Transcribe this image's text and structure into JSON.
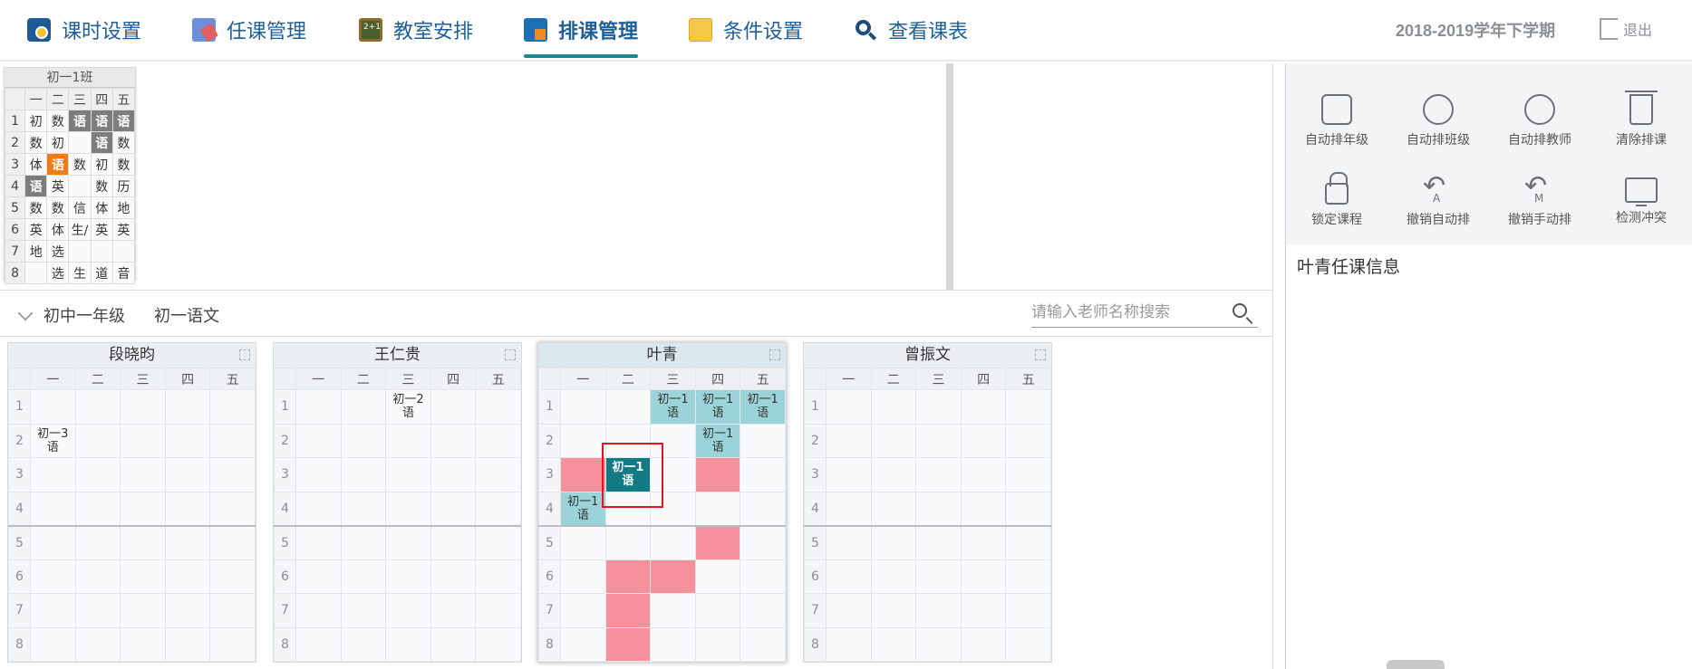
{
  "nav": {
    "items": [
      {
        "label": "课时设置",
        "icon": "clock-icon",
        "color": "#1e5a94"
      },
      {
        "label": "任课管理",
        "icon": "teacher-assign-icon",
        "color": "#3b6fb5"
      },
      {
        "label": "教室安排",
        "icon": "blackboard-icon",
        "color": "#556b2f"
      },
      {
        "label": "排课管理",
        "icon": "schedule-grid-icon",
        "color": "#1c6fb5"
      },
      {
        "label": "条件设置",
        "icon": "note-icon",
        "color": "#e8b93a"
      },
      {
        "label": "查看课表",
        "icon": "search-icon",
        "color": "#1f4d7a"
      }
    ],
    "active_index": 3,
    "term": "2018-2019学年下学期",
    "logout": "退出"
  },
  "preview": {
    "title": "初一1班",
    "days": [
      "一",
      "二",
      "三",
      "四",
      "五"
    ],
    "rows": [
      {
        "n": "1",
        "cells": [
          "初",
          "数",
          "语",
          "语",
          "语"
        ],
        "hl": [
          2,
          3,
          4
        ]
      },
      {
        "n": "2",
        "cells": [
          "数",
          "初",
          "",
          "语",
          "数"
        ],
        "hl": [
          3
        ]
      },
      {
        "n": "3",
        "cells": [
          "体",
          "语",
          "数",
          "初",
          "数"
        ],
        "or": [
          1
        ]
      },
      {
        "n": "4",
        "cells": [
          "语",
          "英",
          "",
          "数",
          "历"
        ],
        "hl": [
          0
        ]
      },
      {
        "n": "5",
        "cells": [
          "数",
          "数",
          "信",
          "体",
          "地"
        ]
      },
      {
        "n": "6",
        "cells": [
          "英",
          "体",
          "生/",
          "英",
          "英"
        ]
      },
      {
        "n": "7",
        "cells": [
          "地",
          "选",
          "",
          "",
          ""
        ]
      },
      {
        "n": "8",
        "cells": [
          "",
          "选",
          "生",
          "道",
          "音"
        ]
      }
    ]
  },
  "filter": {
    "grade": "初中一年级",
    "subject": "初一语文",
    "search_placeholder": "请输入老师名称搜索"
  },
  "teachers": [
    {
      "name": "段晓昀",
      "cells": {
        "2-0": {
          "t": "初一3\n语",
          "c": "plain"
        }
      }
    },
    {
      "name": "王仁贵",
      "cells": {
        "1-2": {
          "t": "初一2\n语",
          "c": "plain"
        }
      }
    },
    {
      "name": "叶青",
      "selected": true,
      "cells": {
        "1-2": {
          "t": "初一1\n语",
          "c": "teal"
        },
        "1-3": {
          "t": "初一1\n语",
          "c": "teal"
        },
        "1-4": {
          "t": "初一1\n语",
          "c": "teal"
        },
        "2-3": {
          "t": "初一1\n语",
          "c": "teal"
        },
        "3-0": {
          "t": "",
          "c": "pink"
        },
        "3-1": {
          "t": "初一1\n语",
          "c": "dark"
        },
        "3-3": {
          "t": "",
          "c": "pink"
        },
        "4-0": {
          "t": "初一1\n语",
          "c": "teal"
        },
        "5-3": {
          "t": "",
          "c": "pink"
        },
        "6-1": {
          "t": "",
          "c": "pink"
        },
        "6-2": {
          "t": "",
          "c": "pink"
        },
        "7-1": {
          "t": "",
          "c": "pink"
        },
        "8-1": {
          "t": "",
          "c": "pink"
        }
      }
    },
    {
      "name": "曾振文",
      "cells": {}
    }
  ],
  "grid_days": [
    "一",
    "二",
    "三",
    "四",
    "五"
  ],
  "grid_periods": [
    "1",
    "2",
    "3",
    "4",
    "5",
    "6",
    "7",
    "8"
  ],
  "actions": [
    {
      "label": "自动排年级",
      "icon": "podium-icon"
    },
    {
      "label": "自动排班级",
      "icon": "class-group-icon"
    },
    {
      "label": "自动排教师",
      "icon": "teacher-icon"
    },
    {
      "label": "清除排课",
      "icon": "trash-icon"
    },
    {
      "label": "锁定课程",
      "icon": "lock-icon"
    },
    {
      "label": "撤销自动排",
      "icon": "undo-auto-icon",
      "mark": "A"
    },
    {
      "label": "撤销手动排",
      "icon": "undo-manual-icon",
      "mark": "M"
    },
    {
      "label": "检测冲突",
      "icon": "monitor-icon"
    }
  ],
  "info_title": "叶青任课信息",
  "colors": {
    "teal": "#9ad4d8",
    "pink": "#f6909c",
    "dark_teal": "#127a84",
    "highlight_gray": "#7d7d7d",
    "highlight_orange": "#ef7d17",
    "nav_text": "#1f5f99"
  }
}
